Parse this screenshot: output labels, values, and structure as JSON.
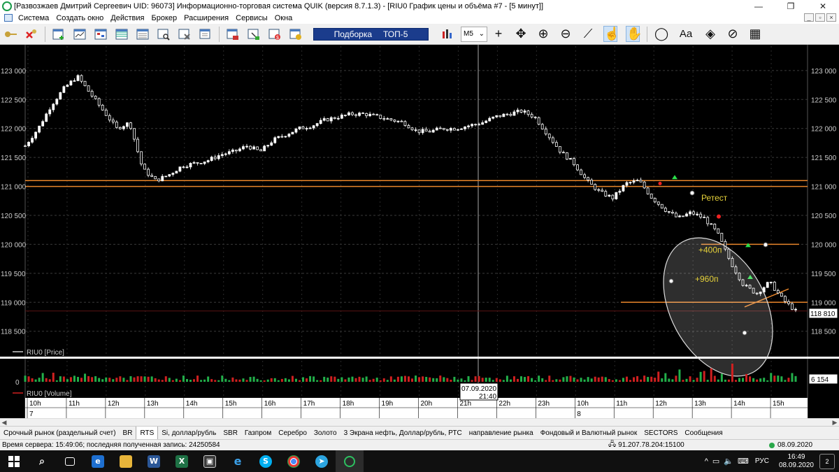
{
  "window": {
    "title": "[Развозжаев Дмитрий Сергеевич UID: 96073] Информационно-торговая система QUIK (версия 8.7.1.3) - [RIU0 График цены и объёма #7 - [5 минут]]",
    "minimize": "—",
    "maximize": "❐",
    "close": "✕"
  },
  "menu": [
    "Система",
    "Создать окно",
    "Действия",
    "Брокер",
    "Расширения",
    "Сервисы",
    "Окна"
  ],
  "toolbar": {
    "selection_label": "Подборка",
    "selection_value": "ТОП-5",
    "interval": "M5",
    "font_tool": "Aa"
  },
  "chart_data": [
    {
      "type": "candlestick",
      "title": "RIU0 [Price]",
      "legend": "RIU0 [Price]",
      "y_ticks": [
        "123 000",
        "122 500",
        "122 000",
        "121 500",
        "121 000",
        "120 500",
        "120 000",
        "119 500",
        "119 000",
        "118 500"
      ],
      "ylim": [
        118400,
        123300
      ],
      "current_price_label": "118 810",
      "current_price": 118810,
      "horizontal_levels": [
        121100,
        121000,
        120000,
        119000
      ],
      "annotations": [
        {
          "text": "Ретест",
          "x_time": "12h30",
          "y": 120800
        },
        {
          "text": "+400п",
          "x_time": "13h20",
          "y": 119900
        },
        {
          "text": "+960п",
          "x_time": "13h15",
          "y": 119400
        }
      ],
      "cursor_time": "07.09.2020 21:40",
      "x_ticks": [
        "10h",
        "11h",
        "12h",
        "13h",
        "14h",
        "15h",
        "16h",
        "17h",
        "18h",
        "19h",
        "20h",
        "21h",
        "22h",
        "23h",
        "10h",
        "11h",
        "12h",
        "13h",
        "14h",
        "15h"
      ],
      "x_date_marks": [
        "7",
        "8"
      ],
      "close_path": [
        121700,
        122000,
        122400,
        122700,
        122900,
        122600,
        122300,
        122000,
        122100,
        121300,
        121100,
        121200,
        121350,
        121400,
        121450,
        121550,
        121600,
        121700,
        121600,
        121800,
        121900,
        122000,
        122050,
        122150,
        122200,
        122250,
        122250,
        122200,
        122150,
        122100,
        121950,
        121950,
        122000,
        122000,
        122050,
        122100,
        122200,
        122250,
        122300,
        122200,
        121900,
        121600,
        121400,
        121100,
        120900,
        120800,
        121050,
        121100,
        120800,
        120600,
        120450,
        120550,
        120450,
        120200,
        119700,
        119300,
        119150,
        119350,
        119050,
        118850
      ]
    },
    {
      "type": "bar",
      "title": "RIU0 [Volume]",
      "legend": "RIU0 [Volume]",
      "y_ticks": [
        "0"
      ],
      "last_value_label": "6 154",
      "last_value": 6154
    }
  ],
  "tabs": [
    "Срочный рынок (раздельный счет)",
    "BR",
    "RTS",
    "Si, доллар/рубль",
    "SBR",
    "Газпром",
    "Серебро",
    "Золото",
    "3 Экрана нефть, Доллар/рубль, РТС",
    "направление рынка",
    "Фондовый и Валютный рынок",
    "SECTORS",
    "Сообщения"
  ],
  "active_tab": "RTS",
  "status": {
    "server": "Время сервера: 15:49:06; последняя полученная запись: 24250584",
    "ip": "91.207.78.204:15100",
    "date": "08.09.2020"
  },
  "taskbar": {
    "lang": "РУС",
    "time": "16:49",
    "date": "08.09.2020",
    "notifications": "2"
  }
}
